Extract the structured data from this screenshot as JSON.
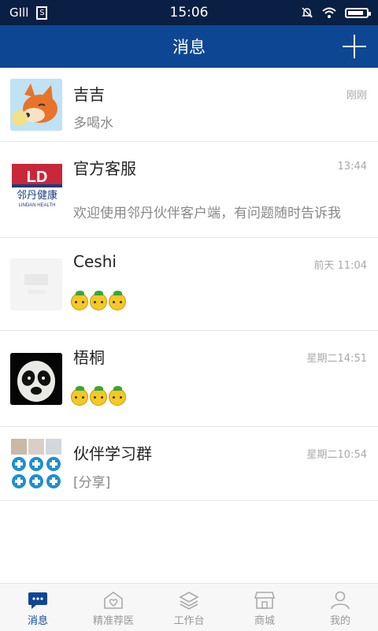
{
  "status_bar": {
    "carrier": "GIll",
    "time": "15:06",
    "battery_level": 0.85
  },
  "header": {
    "title": "消息"
  },
  "conversations": [
    {
      "name": "吉吉",
      "time": "刚刚",
      "preview": "多喝水",
      "emoji_count": 0,
      "avatar": "fox-avatar"
    },
    {
      "name": "官方客服",
      "time": "13:44",
      "preview": "欢迎使用邻丹伙伴客户端，有问题随时告诉我",
      "emoji_count": 0,
      "avatar": "lindan-logo",
      "logo_text": {
        "mark": "LD",
        "cn": "邻丹健康",
        "en": "LINDAN HEALTH"
      }
    },
    {
      "name": "Ceshi",
      "time": "前天 11:04",
      "preview": "",
      "emoji_count": 3,
      "avatar": "faded-lindan-logo"
    },
    {
      "name": "梧桐",
      "time": "星期二14:51",
      "preview": "",
      "emoji_count": 3,
      "avatar": "panda-avatar"
    },
    {
      "name": "伙伴学习群",
      "time": "星期二10:54",
      "preview": "[分享]",
      "emoji_count": 0,
      "avatar": "group-avatar"
    }
  ],
  "tabs": [
    {
      "label": "消息",
      "icon": "chat-bubble-icon",
      "active": true
    },
    {
      "label": "精准荐医",
      "icon": "doctor-icon",
      "active": false
    },
    {
      "label": "工作台",
      "icon": "layers-icon",
      "active": false
    },
    {
      "label": "商城",
      "icon": "shop-icon",
      "active": false
    },
    {
      "label": "我的",
      "icon": "person-icon",
      "active": false
    }
  ],
  "colors": {
    "status_bar": "#0a1f44",
    "header": "#0d4793",
    "accent": "#0d4793",
    "logo_red": "#c8283a"
  }
}
